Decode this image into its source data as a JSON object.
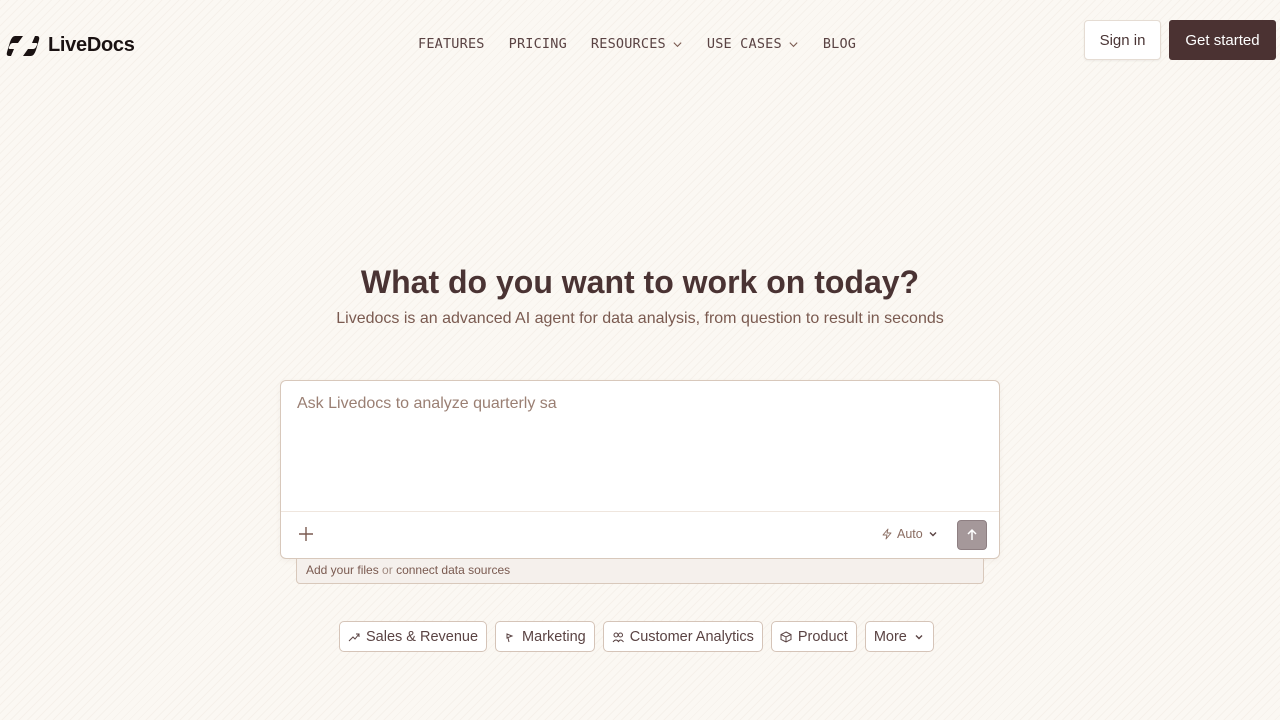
{
  "brand": {
    "name": "LiveDocs"
  },
  "nav": {
    "items": [
      {
        "label": "FEATURES",
        "dropdown": false
      },
      {
        "label": "PRICING",
        "dropdown": false
      },
      {
        "label": "RESOURCES",
        "dropdown": true
      },
      {
        "label": "USE CASES",
        "dropdown": true
      },
      {
        "label": "BLOG",
        "dropdown": false
      }
    ]
  },
  "header": {
    "signin_label": "Sign in",
    "cta_label": "Get started"
  },
  "hero": {
    "title": "What do you want to work on today?",
    "subtitle": "Livedocs is an advanced AI agent for data analysis, from question to result in seconds"
  },
  "prompt": {
    "value": "Ask Livedocs to analyze quarterly sa",
    "mode_label": "Auto"
  },
  "files_bar": {
    "add_files": "Add your files",
    "or": "or",
    "connect": "connect data sources"
  },
  "chips": [
    {
      "label": "Sales & Revenue",
      "icon": "trend-up-icon"
    },
    {
      "label": "Marketing",
      "icon": "megaphone-icon"
    },
    {
      "label": "Customer Analytics",
      "icon": "users-icon"
    },
    {
      "label": "Product",
      "icon": "box-icon"
    },
    {
      "label": "More",
      "icon": "chevron-down-icon"
    }
  ],
  "colors": {
    "primary": "#4b3232",
    "background": "#fbf8f3",
    "send_button": "#a5989a"
  }
}
